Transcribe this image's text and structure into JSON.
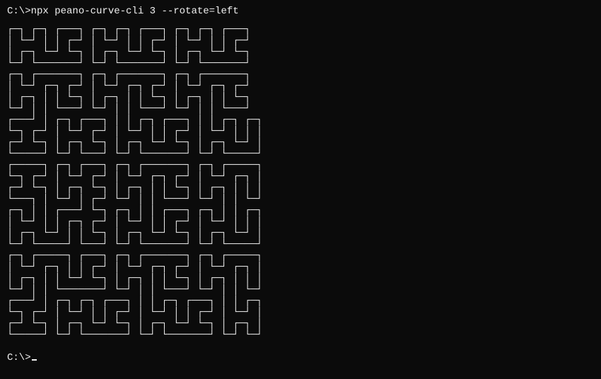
{
  "prompt1": {
    "ps1": "C:\\>",
    "command": "npx peano-curve-cli 3 --rotate=left"
  },
  "prompt2": {
    "ps1": "C:\\>"
  },
  "output": {
    "lines": [
      "┌─┐ ┌─┐ ┌───┐ ┌─┐ ┌─┐ ┌───┐ ┌─┐ ┌─┐ ┌───┐",
      "│ └─┘ │ │ ┌─┘ │ └─┘ │ │ ┌─┘ │ └─┘ │ │ ┌─┘",
      "│ ┌─┐ └─┘ └─┐ │ ┌─┐ └─┘ └─┐ │ ┌─┐ └─┘ └─┐",
      "└─┘ └───────┘ └─┘ └───────┘ └─┘ └───────┘",
      "┌─┐ ┌───────┐ ┌─┐ ┌───────┐ ┌─┐ ┌───────┐",
      "│ └─┘ ┌─┐ ┌─┘ │ └─┘ ┌─┐ ┌─┘ │ └─┘ ┌─┐ ┌─┘",
      "│ ┌─┐ │ │ └─┐ │ ┌─┐ │ │ └─┐ │ ┌─┐ │ │ └─┐",
      "└─┘ │ │ └───┘ └─┘ │ │ └───┘ └─┘ │ │ └───┘",
      "┌───┘ │ ┌─┐ ┌───┐ │ │ ┌─┐ ┌───┐ │ │ ┌─┐ ┌─┐",
      "└─┐ ┌─┘ │ └─┘ ┌─┘ │ └─┘ │ │ ┌─┘ │ └─┘ │ │ │",
      "┌─┘ └─┐ │ ┌─┐ └─┐ │ ┌─┐ └─┘ └─┐ │ ┌─┐ └─┘ │",
      "└─────┘ └─┘ └───┘ └─┘ └───────┘ └─┘ └─────┘",
      "┌─────┐ ┌─┐ ┌───┐ ┌─┐ ┌───────┐ ┌─┐ ┌─────┐",
      "└─┐ ┌─┘ │ └─┘ ┌─┘ │ └─┘ ┌─┐ ┌─┘ │ └─┘ ┌─┐ │",
      "┌─┘ └─┐ │ ┌─┐ └─┐ │ ┌─┐ │ │ └─┐ │ ┌─┐ │ │ │",
      "└───┐ │ └─┘ │ ┌─┘ └─┘ │ │ └───┘ └─┘ │ │ └─┘",
      "┌─┐ │ │ ┌───┘ └─┐ ┌─┐ │ │ ┌───┐ ┌─┐ │ │ ┌─┐",
      "│ └─┘ │ │ ┌─┐ ┌─┘ │ └─┘ │ │ ┌─┘ │ └─┘ │ │ │",
      "│ ┌─┐ └─┘ │ │ └─┐ │ ┌─┐ └─┘ └─┐ │ ┌─┐ └─┘ │",
      "└─┘ └─────┘ └───┘ └─┘ └───────┘ └─┘ └─────┘",
      "┌─┐ ┌─────┐ ┌───┐ ┌─┐ ┌───────┐ ┌─┐ ┌─────┐",
      "│ └─┘ ┌─┐ │ │ ┌─┘ │ └─┘ ┌─┐ ┌─┘ │ └─┘ ┌─┐ │",
      "│ ┌─┐ │ │ └─┘ └─┐ │ ┌─┐ │ │ └─┐ │ ┌─┐ │ │ │",
      "└─┘ │ │ └───────┘ └─┘ │ │ └───┘ └─┘ │ │ └─┘",
      "┌───┘ │ ┌─┐ ┌─┐ ┌───┐ │ │ ┌─┐ ┌───┐ │ │ ┌─┐",
      "└─┐ ┌─┘ │ └─┘ │ │ ┌─┘ │ └─┘ │ │ ┌─┘ │ └─┘ │",
      "┌─┘ └─┐ │ ┌─┐ └─┘ └─┐ │ ┌─┐ └─┘ └─┐ │ ┌─┐ │",
      "└─────┘ └─┘ └───────┘ └─┘ └───────┘ └─┘ └─┘"
    ]
  }
}
